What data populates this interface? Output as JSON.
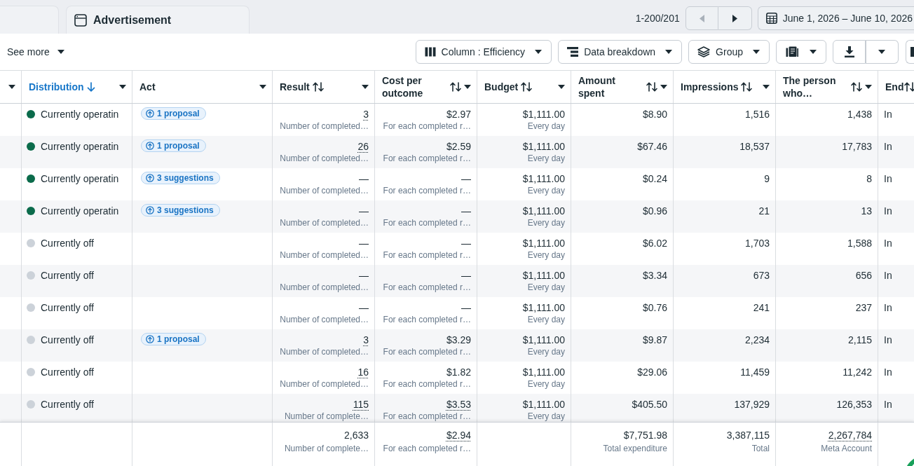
{
  "tabs": [
    {
      "kind": "blank"
    },
    {
      "kind": "labeled",
      "label": "Advertisement"
    }
  ],
  "pager": {
    "range": "1-200/201",
    "buttons": [
      {
        "kind": "previous",
        "disabled": true
      },
      {
        "kind": "next",
        "disabled": false
      }
    ]
  },
  "date_range": {
    "label": "June 1, 2026 – June 10, 2026"
  },
  "toolbar": {
    "see_more": "See more",
    "buttons": [
      {
        "kind": "columns",
        "label": "Column : Efficiency"
      },
      {
        "kind": "breakdown",
        "label": "Data breakdown"
      },
      {
        "kind": "group",
        "label": "Group"
      },
      {
        "kind": "reports"
      },
      {
        "kind": "export"
      },
      {
        "kind": "more"
      }
    ]
  },
  "table": {
    "columns": [
      {
        "sortable": false,
        "sorted": false
      },
      {
        "label": "Distribution",
        "sortable": true,
        "sorted": true
      },
      {
        "label": "Act",
        "sortable": false,
        "sorted": false
      },
      {
        "label": "Result",
        "sortable": true,
        "sorted": false
      },
      {
        "label": "Cost per outcome",
        "sortable": true,
        "sorted": false
      },
      {
        "label": "Budget",
        "sortable": true,
        "sorted": false
      },
      {
        "label": "Amount spent",
        "sortable": true,
        "sorted": false
      },
      {
        "label": "Impressions",
        "sortable": true,
        "sorted": false
      },
      {
        "label": "The person who…",
        "sortable": true,
        "sorted": false
      },
      {
        "label": "End",
        "sortable": true,
        "sorted": false
      }
    ],
    "rows": [
      {
        "status": {
          "label": "Currently operatin",
          "color": "#0b6b4b"
        },
        "act": {
          "label": "1 proposal"
        },
        "result": {
          "value": "3",
          "dotted_underline": true,
          "note": "Number of completed…"
        },
        "cost": {
          "value": "$2.97",
          "dotted_underline": false,
          "note": "For each completed r…"
        },
        "budget": {
          "value": "$1,111.00",
          "note": "Every day"
        },
        "spent": "$8.90",
        "impressions": "1,516",
        "people": "1,438",
        "end": "In"
      },
      {
        "status": {
          "label": "Currently operatin",
          "color": "#0b6b4b"
        },
        "act": {
          "label": "1 proposal"
        },
        "result": {
          "value": "26",
          "dotted_underline": true,
          "note": "Number of completed…"
        },
        "cost": {
          "value": "$2.59",
          "dotted_underline": false,
          "note": "For each completed r…"
        },
        "budget": {
          "value": "$1,111.00",
          "note": "Every day"
        },
        "spent": "$67.46",
        "impressions": "18,537",
        "people": "17,783",
        "end": "In"
      },
      {
        "status": {
          "label": "Currently operatin",
          "color": "#0b6b4b"
        },
        "act": {
          "label": "3 suggestions"
        },
        "result": {
          "value": "—",
          "dotted_underline": false,
          "note": "Number of completed…"
        },
        "cost": {
          "value": "—",
          "dotted_underline": false,
          "note": "For each completed r…"
        },
        "budget": {
          "value": "$1,111.00",
          "note": "Every day"
        },
        "spent": "$0.24",
        "impressions": "9",
        "people": "8",
        "end": "In"
      },
      {
        "status": {
          "label": "Currently operatin",
          "color": "#0b6b4b"
        },
        "act": {
          "label": "3 suggestions"
        },
        "result": {
          "value": "—",
          "dotted_underline": false,
          "note": "Number of completed…"
        },
        "cost": {
          "value": "—",
          "dotted_underline": false,
          "note": "For each completed r…"
        },
        "budget": {
          "value": "$1,111.00",
          "note": "Every day"
        },
        "spent": "$0.96",
        "impressions": "21",
        "people": "13",
        "end": "In"
      },
      {
        "status": {
          "label": "Currently off",
          "color": "#ccd2d9"
        },
        "result": {
          "value": "—",
          "dotted_underline": false,
          "note": "Number of completed…"
        },
        "cost": {
          "value": "—",
          "dotted_underline": false,
          "note": "For each completed r…"
        },
        "budget": {
          "value": "$1,111.00",
          "note": "Every day"
        },
        "spent": "$6.02",
        "impressions": "1,703",
        "people": "1,588",
        "end": "In"
      },
      {
        "status": {
          "label": "Currently off",
          "color": "#ccd2d9"
        },
        "result": {
          "value": "—",
          "dotted_underline": false,
          "note": "Number of completed…"
        },
        "cost": {
          "value": "—",
          "dotted_underline": false,
          "note": "For each completed r…"
        },
        "budget": {
          "value": "$1,111.00",
          "note": "Every day"
        },
        "spent": "$3.34",
        "impressions": "673",
        "people": "656",
        "end": "In"
      },
      {
        "status": {
          "label": "Currently off",
          "color": "#ccd2d9"
        },
        "result": {
          "value": "—",
          "dotted_underline": false,
          "note": "Number of completed…"
        },
        "cost": {
          "value": "—",
          "dotted_underline": false,
          "note": "For each completed r…"
        },
        "budget": {
          "value": "$1,111.00",
          "note": "Every day"
        },
        "spent": "$0.76",
        "impressions": "241",
        "people": "237",
        "end": "In"
      },
      {
        "status": {
          "label": "Currently off",
          "color": "#ccd2d9"
        },
        "act": {
          "label": "1 proposal"
        },
        "result": {
          "value": "3",
          "dotted_underline": true,
          "note": "Number of completed…"
        },
        "cost": {
          "value": "$3.29",
          "dotted_underline": false,
          "note": "For each completed r…"
        },
        "budget": {
          "value": "$1,111.00",
          "note": "Every day"
        },
        "spent": "$9.87",
        "impressions": "2,234",
        "people": "2,115",
        "end": "In"
      },
      {
        "status": {
          "label": "Currently off",
          "color": "#ccd2d9"
        },
        "result": {
          "value": "16",
          "dotted_underline": true,
          "note": "Number of completed…"
        },
        "cost": {
          "value": "$1.82",
          "dotted_underline": false,
          "note": "For each completed r…"
        },
        "budget": {
          "value": "$1,111.00",
          "note": "Every day"
        },
        "spent": "$29.06",
        "impressions": "11,459",
        "people": "11,242",
        "end": "In"
      },
      {
        "status": {
          "label": "Currently off",
          "color": "#ccd2d9"
        },
        "result": {
          "value": "115",
          "dotted_underline": true,
          "note": "Number of complete…"
        },
        "cost": {
          "value": "$3.53",
          "dotted_underline": true,
          "note": "For each completed r…"
        },
        "budget": {
          "value": "$1,111.00",
          "note": "Every day"
        },
        "spent": "$405.50",
        "impressions": "137,929",
        "people": "126,353",
        "end": "In"
      }
    ],
    "summary": {
      "result": {
        "value": "2,633",
        "dotted_underline": false,
        "note": "Number of complete…"
      },
      "cost": {
        "value": "$2.94",
        "dotted_underline": true,
        "note": "For each completed r…"
      },
      "spent": {
        "value": "$7,751.98",
        "dotted_underline": false,
        "note": "Total expenditure"
      },
      "impressions": {
        "value": "3,387,115",
        "dotted_underline": false,
        "note": "Total"
      },
      "people": {
        "value": "2,267,784",
        "dotted_underline": true,
        "note": "Meta Account"
      }
    }
  }
}
